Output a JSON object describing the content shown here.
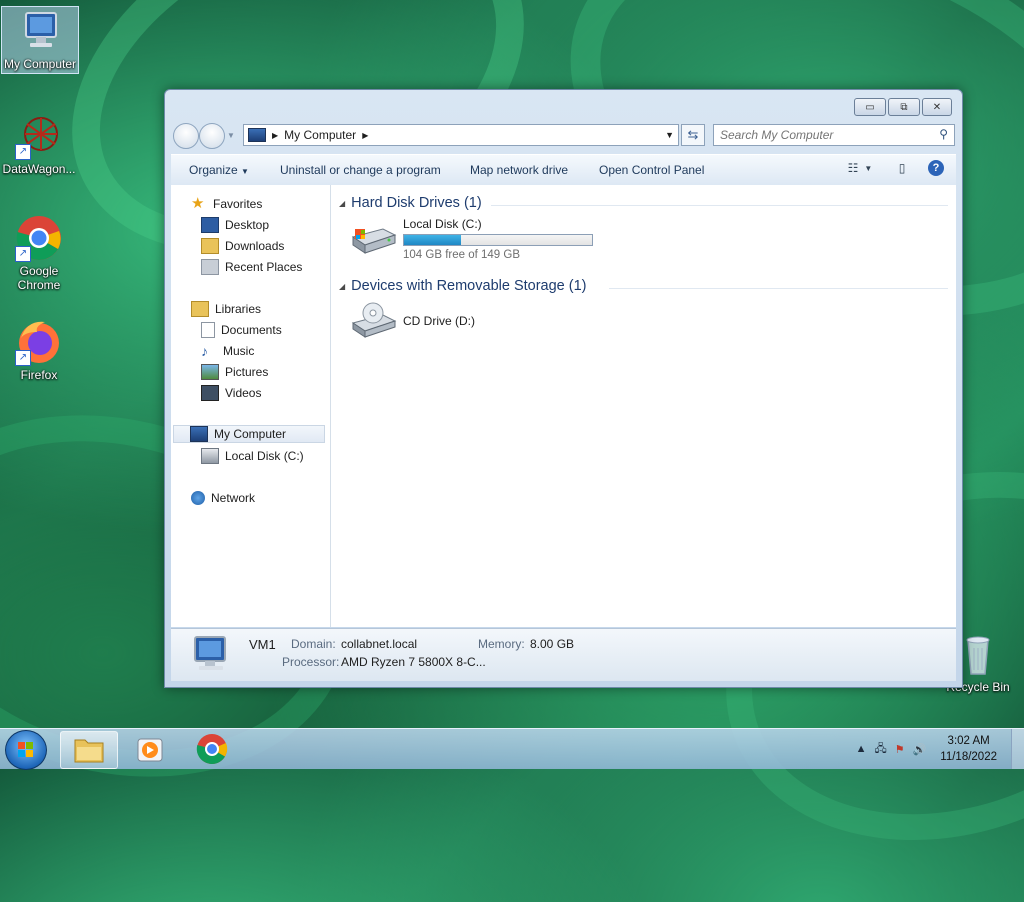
{
  "desktop": {
    "icons": [
      {
        "label": "My Computer",
        "icon": "computer-icon"
      },
      {
        "label": "DataWagon...",
        "icon": "datawagon-icon"
      },
      {
        "label": "Google Chrome",
        "icon": "chrome-icon"
      },
      {
        "label": "Firefox",
        "icon": "firefox-icon"
      },
      {
        "label": "Recycle Bin",
        "icon": "recycle-bin-icon"
      }
    ]
  },
  "window": {
    "title_buttons": {
      "minimize": "▭",
      "maximize": "⧉",
      "close": "✕"
    },
    "address": {
      "crumb": "My Computer"
    },
    "search": {
      "placeholder": "Search My Computer"
    },
    "toolbar": {
      "organize": "Organize",
      "uninstall": "Uninstall or change a program",
      "map_drive": "Map network drive",
      "control_panel": "Open Control Panel"
    },
    "nav": {
      "favorites": "Favorites",
      "desktop": "Desktop",
      "downloads": "Downloads",
      "recent": "Recent Places",
      "libraries": "Libraries",
      "documents": "Documents",
      "music": "Music",
      "pictures": "Pictures",
      "videos": "Videos",
      "my_computer": "My Computer",
      "local_disk": "Local Disk (C:)",
      "network": "Network"
    },
    "groups": {
      "hdd_header": "Hard Disk Drives (1)",
      "removable_header": "Devices with Removable Storage (1)"
    },
    "drives": {
      "c_name": "Local Disk (C:)",
      "c_free": "104 GB free of 149 GB",
      "c_used_fraction": 0.302,
      "d_name": "CD Drive (D:)"
    },
    "details": {
      "name": "VM1",
      "domain_label": "Domain:",
      "domain_value": "collabnet.local",
      "memory_label": "Memory:",
      "memory_value": "8.00 GB",
      "processor_label": "Processor:",
      "processor_value": "AMD Ryzen 7 5800X 8-C..."
    }
  },
  "taskbar": {
    "time": "3:02 AM",
    "date": "11/18/2022"
  }
}
